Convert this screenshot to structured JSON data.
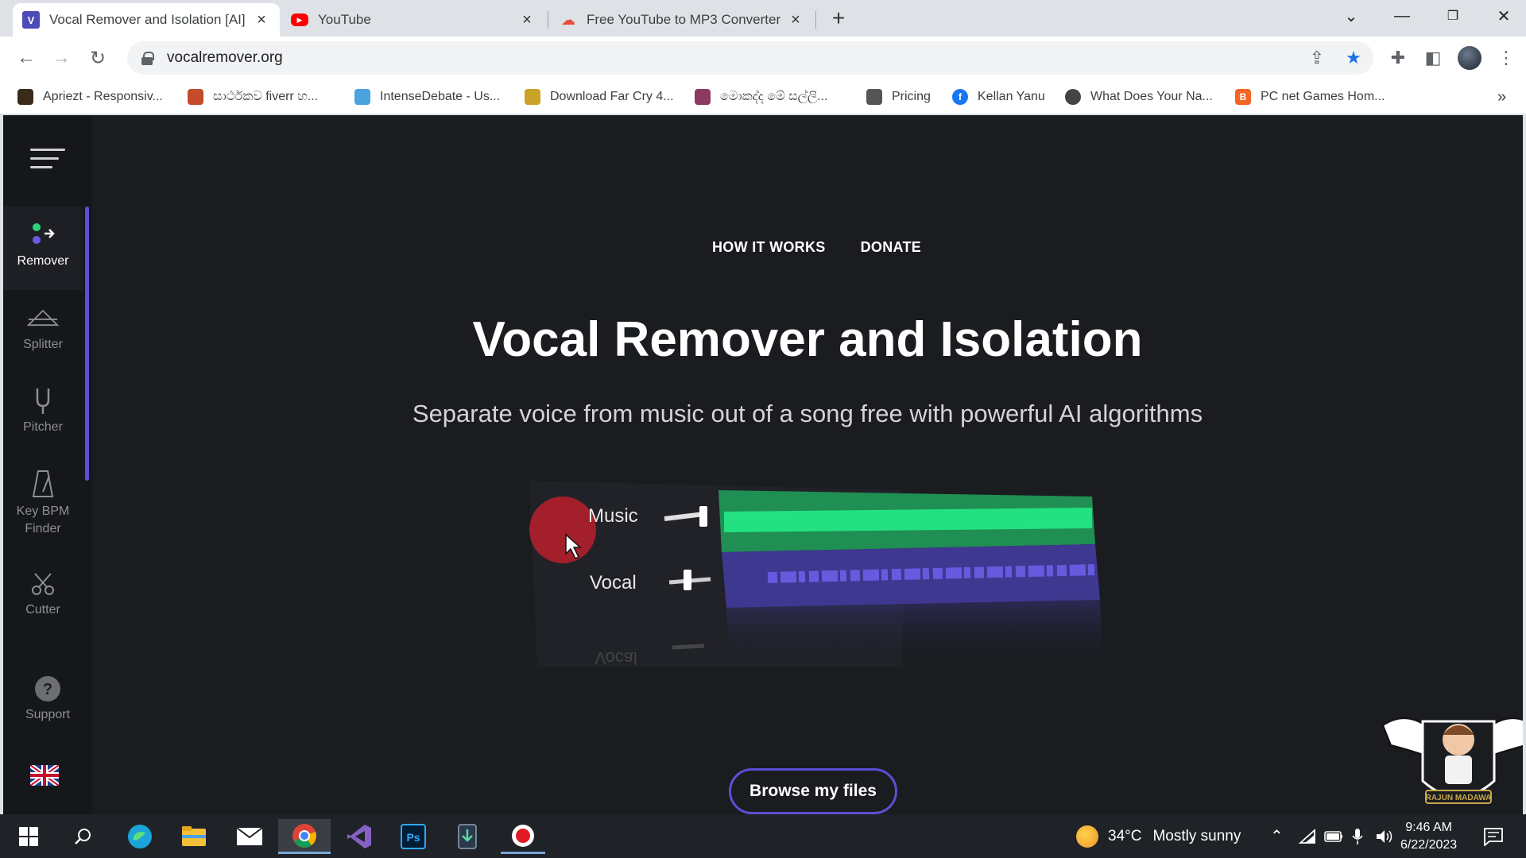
{
  "browser": {
    "tabs": [
      {
        "title": "Vocal Remover and Isolation [AI]",
        "active": true,
        "favicon": "v-logo-icon"
      },
      {
        "title": "YouTube",
        "active": false,
        "favicon": "youtube-icon"
      },
      {
        "title": "Free YouTube to MP3 Converter",
        "active": false,
        "favicon": "cloud-download-icon"
      }
    ],
    "url": "vocalremover.org",
    "bookmarks": [
      {
        "label": "Apriezt - Responsiv...",
        "color": "#3a2a1a"
      },
      {
        "label": "සාර්ථකව fiverr හ...",
        "color": "#c44b2b"
      },
      {
        "label": "IntenseDebate - Us...",
        "color": "#4aa3df"
      },
      {
        "label": "Download Far Cry 4...",
        "color": "#c9a227"
      },
      {
        "label": "මොකද්ද මේ සල්ලි...",
        "color": "#8b3a62"
      },
      {
        "label": "Pricing",
        "color": "#555555"
      },
      {
        "label": "Kellan Yanu",
        "color": "#1877f2"
      },
      {
        "label": "What Does Your Na...",
        "color": "#444444"
      },
      {
        "label": "PC net Games Hom...",
        "color": "#f26522"
      }
    ],
    "overflow": "»"
  },
  "sidebar": {
    "items": [
      {
        "label": "Remover",
        "active": true
      },
      {
        "label": "Splitter",
        "active": false
      },
      {
        "label": "Pitcher",
        "active": false
      },
      {
        "label": "Key BPM Finder",
        "active": false
      },
      {
        "label": "Cutter",
        "active": false
      },
      {
        "label": "Support",
        "active": false
      }
    ],
    "language": "uk-flag-icon"
  },
  "main": {
    "nav": {
      "how_it_works": "HOW IT WORKS",
      "donate": "DONATE"
    },
    "title": "Vocal Remover and Isolation",
    "subtitle": "Separate voice from music out of a song free with powerful AI algorithms",
    "tracks": [
      {
        "label": "Music",
        "color": "#1fd67a"
      },
      {
        "label": "Vocal",
        "color": "#5a4fc8"
      }
    ],
    "reflection_label": "Vocal",
    "browse_label": "Browse my files",
    "watermark_text": "RAJUN MADAWA"
  },
  "taskbar": {
    "weather": {
      "temp": "34°C",
      "condition": "Mostly sunny"
    },
    "time": "9:46 AM",
    "date": "6/22/2023"
  },
  "colors": {
    "accent": "#5b4fd6",
    "page_bg": "#1a1c20",
    "sidebar_bg": "#15171b"
  }
}
